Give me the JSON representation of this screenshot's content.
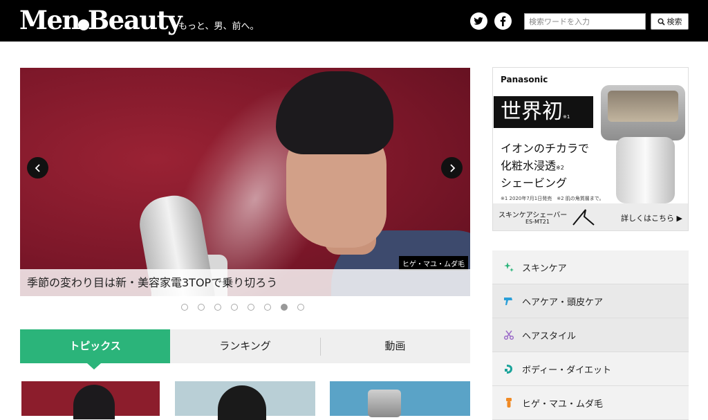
{
  "header": {
    "logo": "MenBeauty",
    "tagline": "もっと、男、前へ。",
    "search_placeholder": "検索ワードを入力",
    "search_button": "検索"
  },
  "slider": {
    "caption": "季節の変わり目は新・美容家電3TOPで乗り切ろう",
    "tag": "ヒゲ・マユ・ムダ毛",
    "dot_count": 8,
    "active_dot": 7
  },
  "tabs": [
    {
      "label": "トピックス",
      "active": true
    },
    {
      "label": "ランキング",
      "active": false
    },
    {
      "label": "動画",
      "active": false
    }
  ],
  "ad": {
    "brand": "Panasonic",
    "headline": "世界初",
    "headline_note": "※1",
    "line1": "イオンのチカラで",
    "line2": "化粧水浸透",
    "line2_note": "※2",
    "line3": "シェービング",
    "footnote": "※1 2020年7月1日発売　※2 肌の角質層まで。",
    "product": "スキンケアシェーバー",
    "model": "ES-MT21",
    "more": "詳しくはこちら ▶"
  },
  "categories": [
    {
      "label": "スキンケア",
      "icon": "sparkle-icon",
      "color": "#2bb47a"
    },
    {
      "label": "ヘアケア・頭皮ケア",
      "icon": "hairdryer-icon",
      "color": "#2a9fd8"
    },
    {
      "label": "ヘアスタイル",
      "icon": "scissors-icon",
      "color": "#9b6bc8"
    },
    {
      "label": "ボディー・ダイエット",
      "icon": "body-icon",
      "color": "#1aa39a"
    },
    {
      "label": "ヒゲ・マユ・ムダ毛",
      "icon": "razor-icon",
      "color": "#f08a24"
    }
  ],
  "colors": {
    "accent_green": "#2bb47a",
    "header_bg": "#000000"
  }
}
